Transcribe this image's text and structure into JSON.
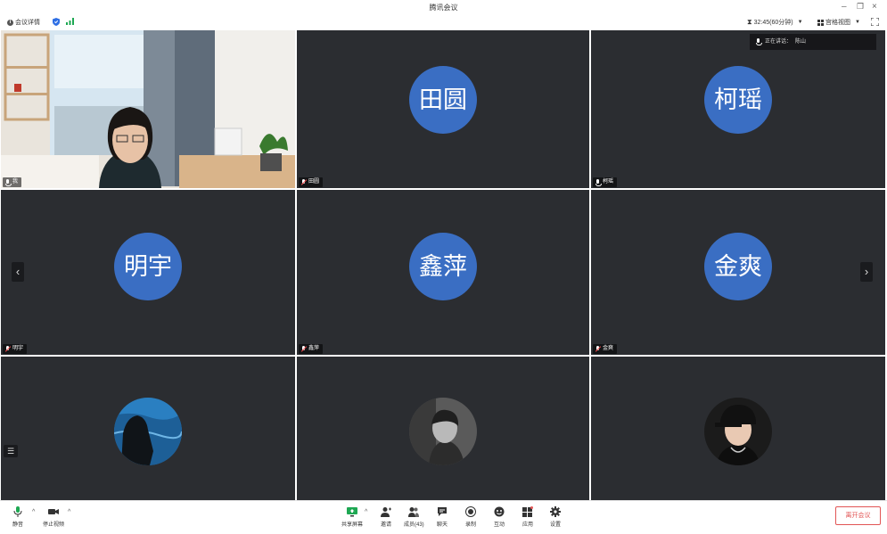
{
  "window": {
    "title": "腾讯会议",
    "minimize_glyph": "–",
    "restore_glyph": "❐",
    "close_glyph": "×"
  },
  "toolbar": {
    "meeting_info_label": "会议详情",
    "duration_label": "32:45(60分钟)",
    "view_label": "宫格视图"
  },
  "speaking_panel": {
    "label": "正在讲话：",
    "names": "陈山"
  },
  "participants": [
    {
      "name": "我",
      "display": "video",
      "muted": false
    },
    {
      "name": "田圆",
      "avatar_text": "田圆",
      "display": "initials",
      "muted": true
    },
    {
      "name": "柯瑶",
      "avatar_text": "柯瑶",
      "display": "initials",
      "muted": false
    },
    {
      "name": "明宇",
      "avatar_text": "明宇",
      "display": "initials",
      "muted": true
    },
    {
      "name": "鑫萍",
      "avatar_text": "鑫萍",
      "display": "initials",
      "muted": true
    },
    {
      "name": "金爽",
      "avatar_text": "金爽",
      "display": "initials",
      "muted": true
    },
    {
      "name": "",
      "display": "photo",
      "photo_icon": "silhouette-by-sea"
    },
    {
      "name": "",
      "display": "photo",
      "photo_icon": "grayscale-portrait"
    },
    {
      "name": "",
      "display": "photo",
      "photo_icon": "portrait-cap"
    }
  ],
  "nav": {
    "prev_glyph": "‹",
    "next_glyph": "›",
    "list_glyph": "☰"
  },
  "bottom": {
    "mute_label": "静音",
    "stop_video_label": "停止视频",
    "share_label": "共享屏幕",
    "invite_label": "邀请",
    "members_label": "成员(43)",
    "chat_label": "聊天",
    "record_label": "录制",
    "interact_label": "互动",
    "apps_label": "应用",
    "settings_label": "设置",
    "leave_label": "离开会议",
    "caret_glyph": "^"
  },
  "colors": {
    "avatar_blue": "#3a6ec3",
    "tile_bg": "#2b2d31",
    "speaking_green": "#1ea853",
    "leave_red": "#e25555",
    "shield_blue": "#2f6fe4",
    "signal_green": "#1ea853"
  }
}
